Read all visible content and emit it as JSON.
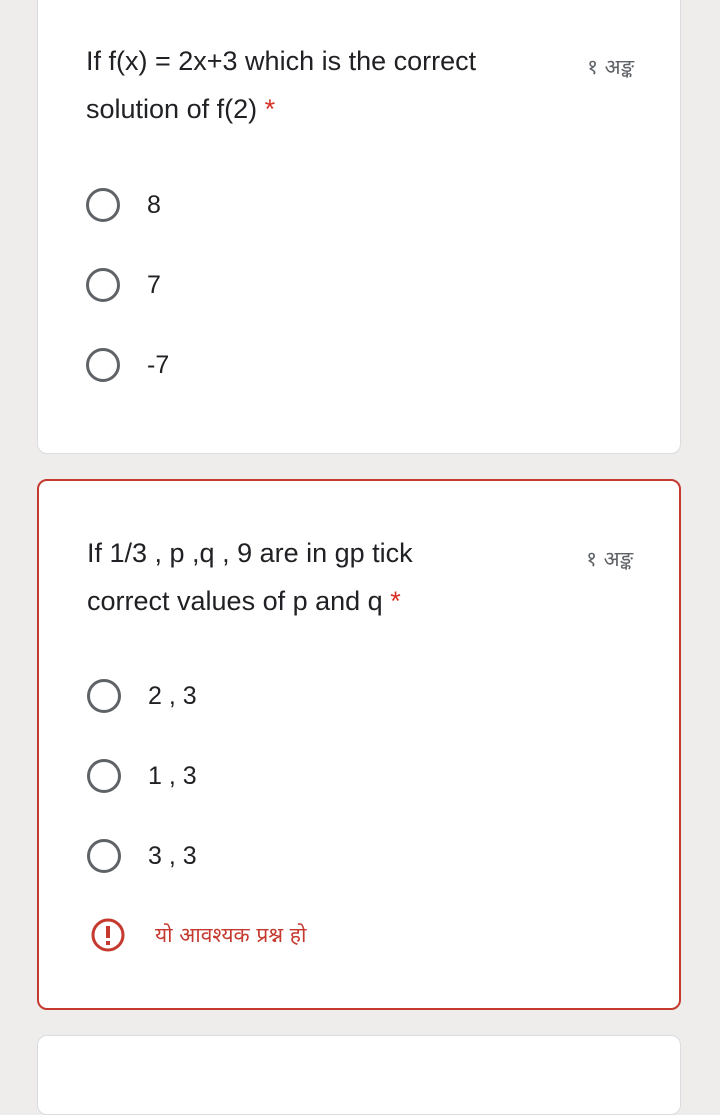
{
  "colors": {
    "background": "#efedec",
    "card": "#ffffff",
    "error": "#c5392f",
    "required": "#d93025",
    "radio": "#5f6368"
  },
  "questions": [
    {
      "title": "If f(x) = 2x+3 which is the correct solution of f(2)",
      "required_marker": "*",
      "points": "१ अङ्क",
      "options": [
        "8",
        "7",
        "-7"
      ]
    },
    {
      "title": "If 1/3 , p ,q , 9 are in gp tick correct values of p and q",
      "required_marker": "*",
      "points": "१ अङ्क",
      "options": [
        "2 , 3",
        "1 , 3",
        "3 , 3"
      ],
      "error": {
        "icon": "error-exclamation-icon",
        "message": "यो आवश्यक प्रश्न हो"
      }
    }
  ]
}
